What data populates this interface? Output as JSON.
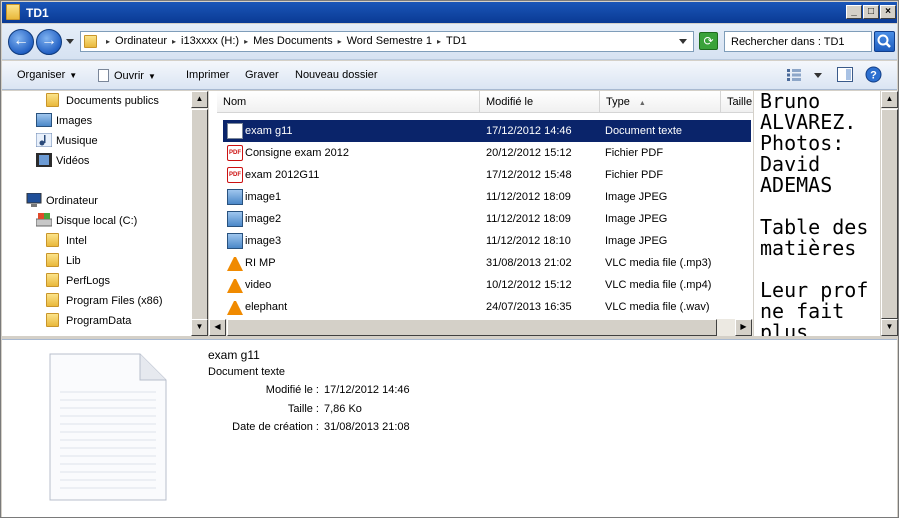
{
  "window": {
    "title": "TD1"
  },
  "address": {
    "crumbs": [
      "Ordinateur",
      "i13xxxx (H:)",
      "Mes Documents",
      "Word Semestre 1",
      "TD1"
    ]
  },
  "search": {
    "placeholder": "Rechercher dans : TD1"
  },
  "toolbar": {
    "organize_label": "Organiser",
    "open_label": "Ouvrir",
    "print_label": "Imprimer",
    "burn_label": "Graver",
    "new_folder_label": "Nouveau dossier"
  },
  "nav": {
    "items": [
      {
        "label": "Documents publics",
        "icon": "folder-icon"
      },
      {
        "label": "Images",
        "icon": "pictures-icon"
      },
      {
        "label": "Musique",
        "icon": "music-icon"
      },
      {
        "label": "Vidéos",
        "icon": "videos-icon"
      },
      {
        "label": "Ordinateur",
        "icon": "computer-icon"
      },
      {
        "label": "Disque local (C:)",
        "icon": "drive-icon"
      },
      {
        "label": "Intel",
        "icon": "folder-icon"
      },
      {
        "label": "Lib",
        "icon": "folder-icon"
      },
      {
        "label": "PerfLogs",
        "icon": "folder-icon"
      },
      {
        "label": "Program Files (x86)",
        "icon": "folder-icon"
      },
      {
        "label": "ProgramData",
        "icon": "folder-icon"
      }
    ]
  },
  "columns": {
    "name": "Nom",
    "modified": "Modifié le",
    "type": "Type",
    "size": "Taille"
  },
  "files": [
    {
      "name": "exam g11",
      "modified": "17/12/2012 14:46",
      "type": "Document texte",
      "icon": "text-document-icon",
      "selected": true
    },
    {
      "name": "Consigne exam 2012",
      "modified": "20/12/2012 15:12",
      "type": "Fichier PDF",
      "icon": "pdf-icon"
    },
    {
      "name": "exam 2012G11",
      "modified": "17/12/2012 15:48",
      "type": "Fichier PDF",
      "icon": "pdf-icon"
    },
    {
      "name": "image1",
      "modified": "11/12/2012 18:09",
      "type": "Image JPEG",
      "icon": "image-icon"
    },
    {
      "name": "image2",
      "modified": "11/12/2012 18:09",
      "type": "Image JPEG",
      "icon": "image-icon"
    },
    {
      "name": "image3",
      "modified": "11/12/2012 18:10",
      "type": "Image JPEG",
      "icon": "image-icon"
    },
    {
      "name": "RI MP",
      "modified": "31/08/2013 21:02",
      "type": "VLC media file (.mp3)",
      "icon": "vlc-icon"
    },
    {
      "name": "video",
      "modified": "10/12/2012 15:12",
      "type": "VLC media file (.mp4)",
      "icon": "vlc-icon"
    },
    {
      "name": "elephant",
      "modified": "24/07/2013 16:35",
      "type": "VLC media file (.wav)",
      "icon": "vlc-icon"
    }
  ],
  "preview": {
    "text": "Bruno\nALVAREZ.\nPhotos:\nDavid\nADEMAS\n\nTable des\nmatières\n\nLeur prof\nne fait\nplus"
  },
  "details": {
    "name": "exam g11",
    "type": "Document texte",
    "modified_label": "Modifié le :",
    "modified_value": "17/12/2012 14:46",
    "size_label": "Taille :",
    "size_value": "7,86 Ko",
    "created_label": "Date de création :",
    "created_value": "31/08/2013 21:08"
  }
}
